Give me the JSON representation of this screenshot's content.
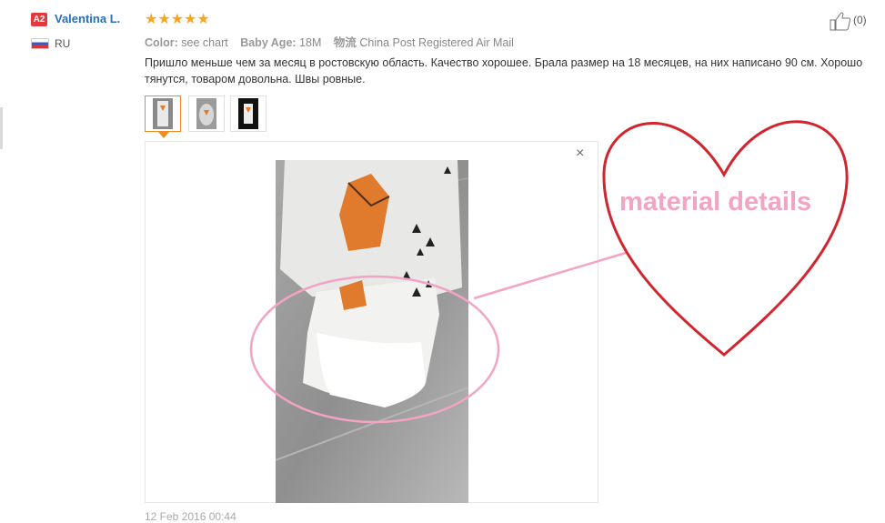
{
  "reviewer": {
    "level_badge": "A2",
    "name": "Valentina L.",
    "country": "RU"
  },
  "rating": {
    "stars": 5,
    "stars_text": "★★★★★"
  },
  "meta": {
    "color_label": "Color:",
    "color_value": "see chart",
    "age_label": "Baby Age:",
    "age_value": "18M",
    "shipping_label": "物流",
    "shipping_value": "China Post Registered Air Mail"
  },
  "review_text": "Пришло меньше чем за месяц в ростовскую область. Качество хорошее. Брала размер на 18 месяцев, на них написано 90 см. Хорошо тянутся, товаром довольна. Швы ровные.",
  "helpful": {
    "count": "(0)"
  },
  "photos": {
    "close_glyph": "×"
  },
  "date": "12 Feb 2016 00:44",
  "annotation": {
    "label": "material details",
    "heart_color": "#d2262f",
    "ellipse_color": "#f3a3c3"
  },
  "colors": {
    "link": "#2a6ebb",
    "star": "#f6a623",
    "accent": "#f08a24",
    "badge": "#e4393c"
  }
}
